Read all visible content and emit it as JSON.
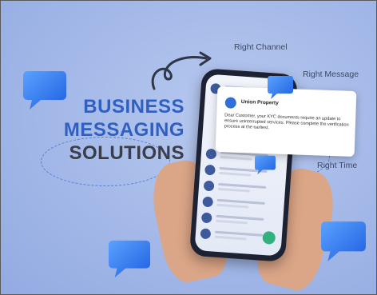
{
  "headline": {
    "line1": "BUSINESS",
    "line2": "MESSAGING",
    "line3": "SOLUTIONS"
  },
  "labels": {
    "channel": "Right Channel",
    "message": "Right Message",
    "time": "Right Time"
  },
  "message_card": {
    "sender": "Union Property",
    "body": "Dear Customer, your KYC documents require an update to ensure uninterrupted services. Please complete the verification process at the earliest."
  },
  "colors": {
    "background": "#a3b8e8",
    "headline_blue": "#2f5fc0",
    "headline_dark": "#3a3d4a",
    "bubble": "#2f7ef0"
  }
}
